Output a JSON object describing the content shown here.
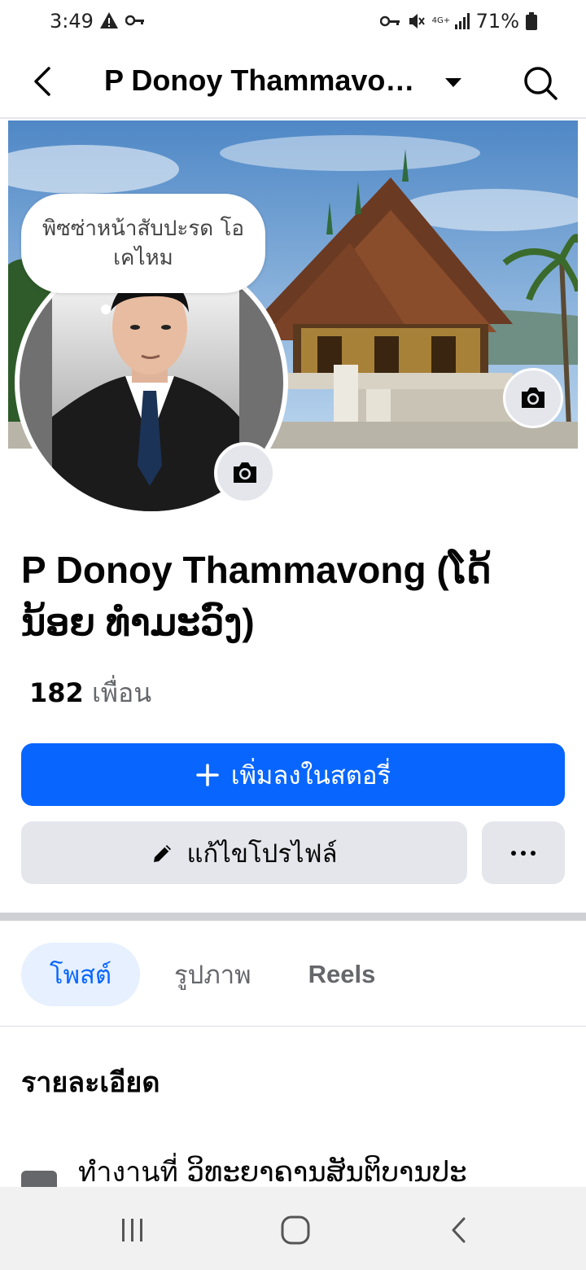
{
  "status_bar": {
    "time": "3:49",
    "network": "4G+",
    "battery": "71%"
  },
  "header": {
    "title": "P Donoy Thammavong (ໂດ້ນ້ອຍ ທຳມະວົງ)"
  },
  "note": {
    "text": "พิซซ่าหน้าสับปะรด โอเคไหม"
  },
  "profile": {
    "name": "P Donoy Thammavong (ໂດ້ ນ້ອຍ ທຳມະວົງ)",
    "friends_count": "182",
    "friends_label": "เพื่อน"
  },
  "actions": {
    "add_story": "เพิ่มลงในสตอรี่",
    "edit_profile": "แก้ไขโปรไฟล์"
  },
  "tabs": [
    {
      "label": "โพสต์",
      "active": true
    },
    {
      "label": "รูปภาพ",
      "active": false
    },
    {
      "label": "Reels",
      "active": false
    }
  ],
  "details": {
    "title": "รายละเอียด",
    "work": "ทำงานที่ ວິທະຍາຄານສັນຕິບານປະ"
  },
  "colors": {
    "primary": "#0866ff",
    "secondary_button": "#e4e6eb",
    "active_tab_bg": "#e7f0ff"
  }
}
